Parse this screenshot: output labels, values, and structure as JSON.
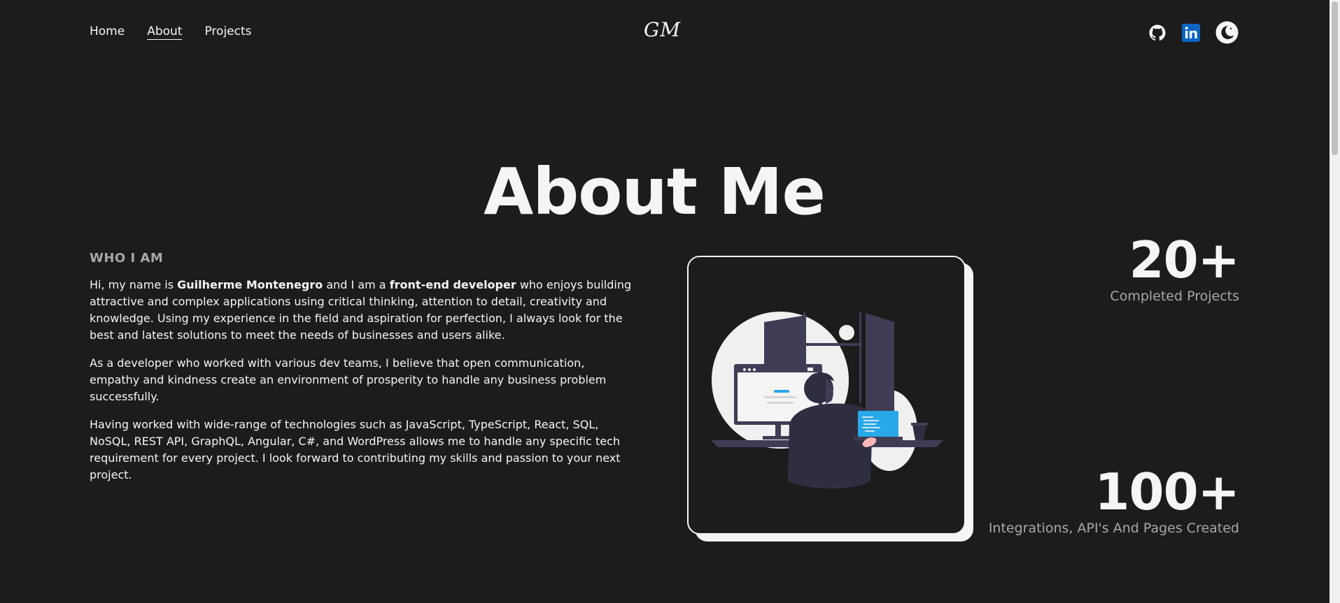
{
  "nav": {
    "items": [
      {
        "label": "Home",
        "active": false
      },
      {
        "label": "About",
        "active": true
      },
      {
        "label": "Projects",
        "active": false
      }
    ]
  },
  "logo": "GM",
  "social": {
    "github_icon": "github-icon",
    "linkedin_icon": "linkedin-icon",
    "theme_icon": "moon-theme-toggle-icon"
  },
  "heading": "About Me",
  "who": {
    "title": "WHO I AM",
    "p1": {
      "pre": "Hi, my name is ",
      "name": "Guilherme Montenegro",
      "mid": " and I am a ",
      "role": "front-end developer",
      "post": " who enjoys building attractive and complex applications using critical thinking, attention to detail, creativity and knowledge. Using my experience in the field and aspiration for perfection, I always look for the best and latest solutions to meet the needs of businesses and users alike."
    },
    "p2": "As a developer who worked with various dev teams, I believe that open communication, empathy and kindness create an environment of prosperity to handle any business problem successfully.",
    "p3": "Having worked with wide-range of technologies such as JavaScript, TypeScript, React, SQL, NoSQL, REST API, GraphQL, Angular, C#, and WordPress allows me to handle any specific tech requirement for every project. I look forward to contributing my skills and passion to your next project."
  },
  "stats": [
    {
      "value": "20+",
      "label": "Completed Projects"
    },
    {
      "value": "100+",
      "label": "Integrations, API's And Pages Created"
    }
  ],
  "colors": {
    "background": "#1c1c1c",
    "text": "#f5f5f5",
    "muted": "#a8a8a8",
    "linkedin": "#0a66c2",
    "screen_accent": "#29a8e8"
  }
}
